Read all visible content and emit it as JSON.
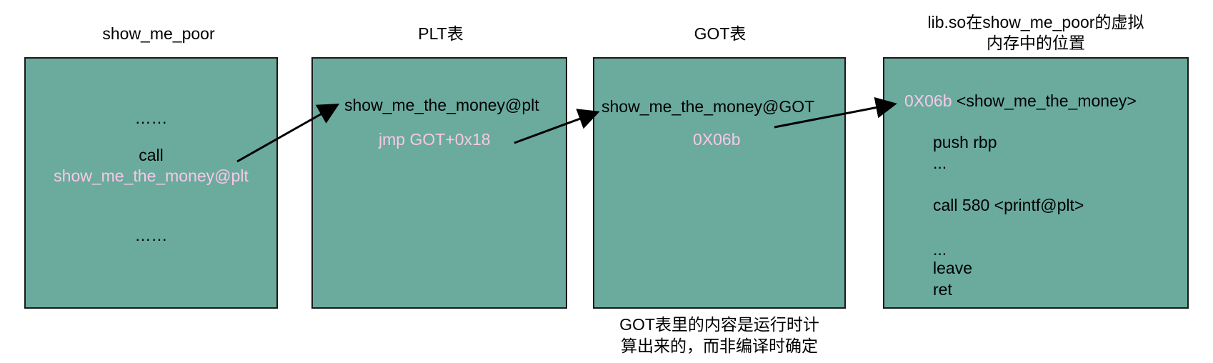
{
  "colors": {
    "box_fill": "#6aab9e",
    "highlight_text": "#f7c8e6",
    "stroke": "#1a1a1a"
  },
  "titles": {
    "show_me_poor": "show_me_poor",
    "plt": "PLT表",
    "got": "GOT表",
    "lib_line1": "lib.so在show_me_poor的虚拟",
    "lib_line2": "内存中的位置"
  },
  "box1": {
    "dots_top": "……",
    "call": "call",
    "call_target": "show_me_the_money@plt",
    "dots_bottom": "……"
  },
  "box2": {
    "label": "show_me_the_money@plt",
    "instruction": "jmp GOT+0x18"
  },
  "box3": {
    "label": "show_me_the_money@GOT",
    "value": "0X06b"
  },
  "box4": {
    "address": "0X06b",
    "symbol": "<show_me_the_money>",
    "line_push": "push rbp",
    "line_dots1": "...",
    "line_call": "call 580 <printf@plt>",
    "line_dots2": "...",
    "line_leave": "leave",
    "line_ret": "ret"
  },
  "note": {
    "line1": "GOT表里的内容是运行时计",
    "line2": "算出来的，而非编译时确定"
  }
}
